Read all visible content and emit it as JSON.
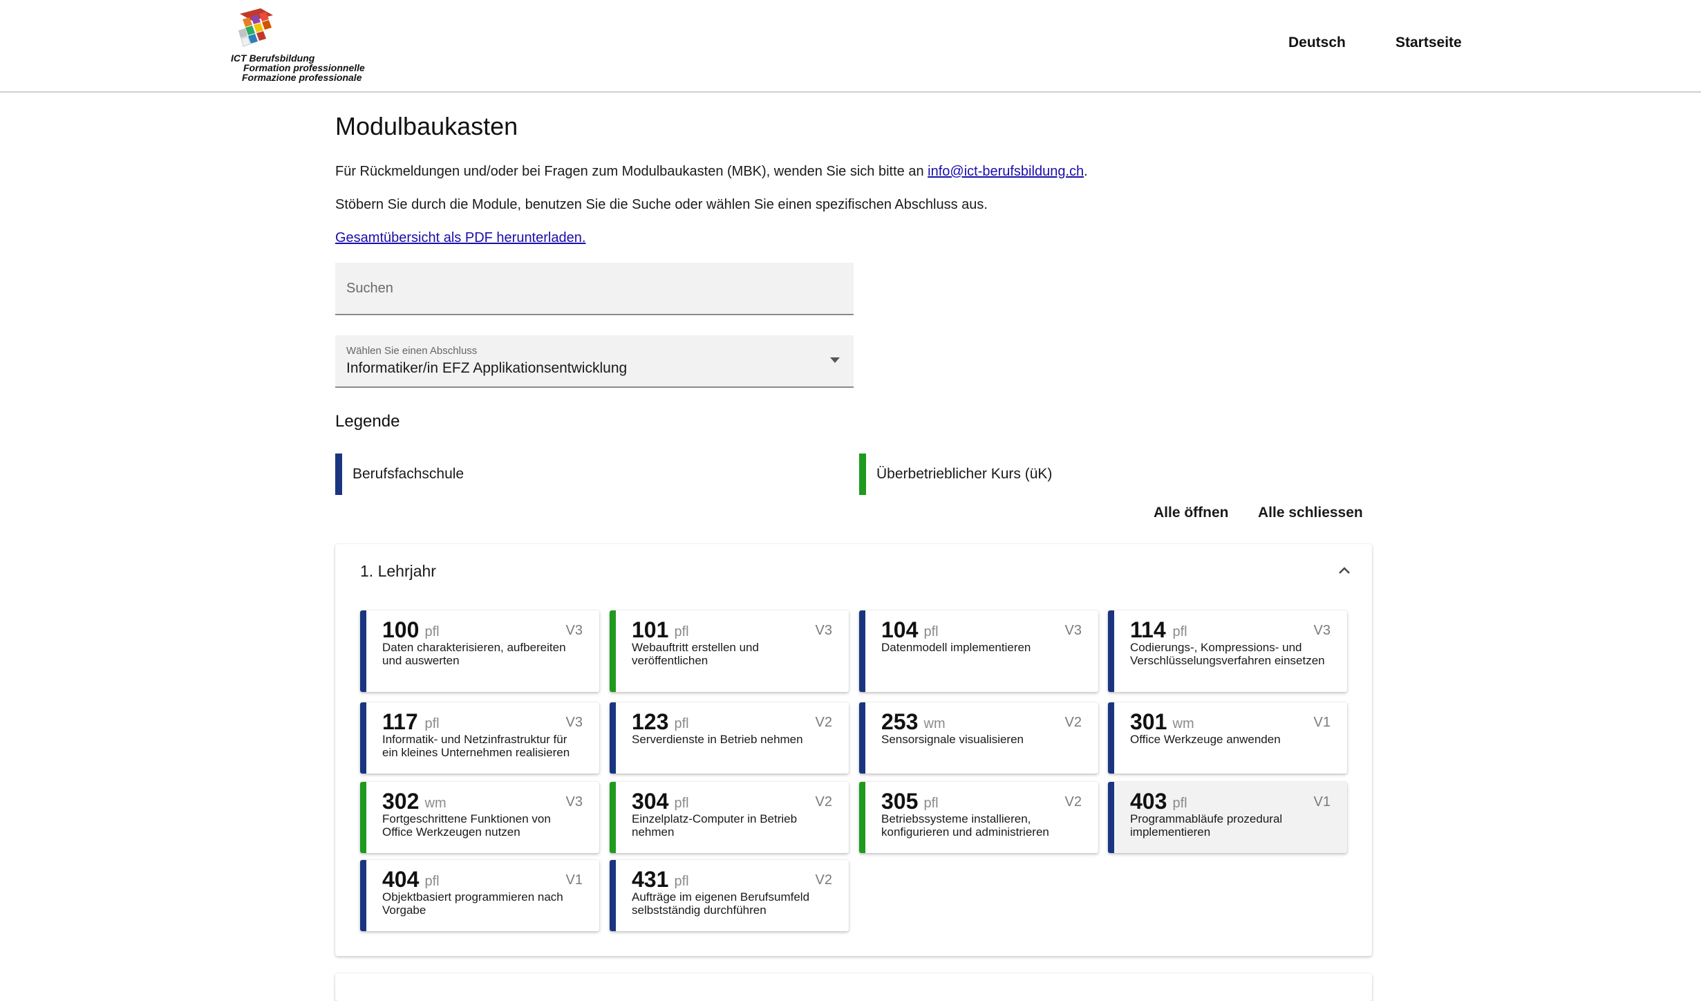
{
  "header": {
    "logo_lines": [
      "ICT Berufsbildung",
      "Formation professionnelle",
      "Formazione professionale"
    ],
    "nav": [
      "Deutsch",
      "Startseite"
    ]
  },
  "main": {
    "title": "Modulbaukasten",
    "feedback_text": "Für Rückmeldungen und/oder bei Fragen zum Modulbaukasten (MBK), wenden Sie sich bitte an ",
    "feedback_email": "info@ict-berufsbildung.ch",
    "feedback_end": ".",
    "browse_text": "Stöbern Sie durch die Module, benutzen Sie die Suche oder wählen Sie einen spezifischen Abschluss aus.",
    "pdf_link": "Gesamtübersicht als PDF herunterladen.",
    "search_placeholder": "Suchen",
    "select_label": "Wählen Sie einen Abschluss",
    "select_value": "Informatiker/in EFZ Applikationsentwicklung"
  },
  "legend": {
    "title": "Legende",
    "items": [
      {
        "label": "Berufsfachschule",
        "color": "#1a3580"
      },
      {
        "label": "Überbetrieblicher Kurs (üK)",
        "color": "#1e9a1e"
      }
    ]
  },
  "actions": {
    "open_all": "Alle öffnen",
    "close_all": "Alle schliessen"
  },
  "colors": {
    "school": "#1a3580",
    "uek": "#1e9a1e"
  },
  "year1": {
    "title": "1. Lehrjahr",
    "modules": [
      {
        "num": "100",
        "kind": "pfl",
        "ver": "V3",
        "desc": "Daten charakterisieren, aufbereiten und auswerten",
        "type": "school"
      },
      {
        "num": "101",
        "kind": "pfl",
        "ver": "V3",
        "desc": "Webauftritt erstellen und veröffentlichen",
        "type": "uek"
      },
      {
        "num": "104",
        "kind": "pfl",
        "ver": "V3",
        "desc": "Datenmodell implementieren",
        "type": "school"
      },
      {
        "num": "114",
        "kind": "pfl",
        "ver": "V3",
        "desc": "Codierungs-, Kompressions- und Verschlüsselungsverfahren einsetzen",
        "type": "school"
      },
      {
        "num": "117",
        "kind": "pfl",
        "ver": "V3",
        "desc": "Informatik- und Netzinfrastruktur für ein kleines Unternehmen realisieren",
        "type": "school"
      },
      {
        "num": "123",
        "kind": "pfl",
        "ver": "V2",
        "desc": "Serverdienste in Betrieb nehmen",
        "type": "school"
      },
      {
        "num": "253",
        "kind": "wm",
        "ver": "V2",
        "desc": "Sensorsignale visualisieren",
        "type": "school"
      },
      {
        "num": "301",
        "kind": "wm",
        "ver": "V1",
        "desc": "Office Werkzeuge anwenden",
        "type": "school"
      },
      {
        "num": "302",
        "kind": "wm",
        "ver": "V3",
        "desc": "Fortgeschrittene Funktionen von Office Werkzeugen nutzen",
        "type": "uek"
      },
      {
        "num": "304",
        "kind": "pfl",
        "ver": "V2",
        "desc": "Einzelplatz-Computer in Betrieb nehmen",
        "type": "uek"
      },
      {
        "num": "305",
        "kind": "pfl",
        "ver": "V2",
        "desc": "Betriebssysteme installieren, konfigurieren und administrieren",
        "type": "uek"
      },
      {
        "num": "403",
        "kind": "pfl",
        "ver": "V1",
        "desc": "Programmabläufe prozedural implementieren",
        "type": "school"
      },
      {
        "num": "404",
        "kind": "pfl",
        "ver": "V1",
        "desc": "Objektbasiert programmieren nach Vorgabe",
        "type": "school"
      },
      {
        "num": "431",
        "kind": "pfl",
        "ver": "V2",
        "desc": "Aufträge im eigenen Berufsumfeld selbstständig durchführen",
        "type": "school"
      }
    ]
  }
}
